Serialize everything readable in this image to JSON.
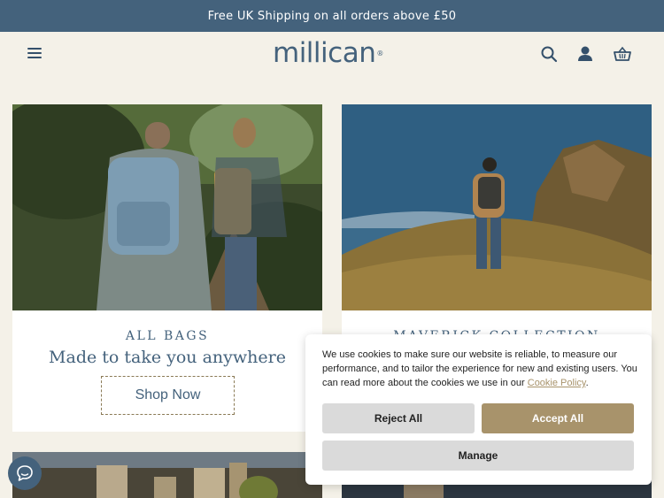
{
  "promo_bar": {
    "text": "Free UK Shipping on all orders above £50"
  },
  "header": {
    "logo_text": "millican",
    "logo_mark": "®",
    "icons": [
      "menu-icon",
      "search-icon",
      "account-icon",
      "basket-icon"
    ]
  },
  "cards": [
    {
      "eyebrow": "ALL BAGS",
      "title": "Made to take you anywhere",
      "button": "Shop Now"
    },
    {
      "eyebrow": "MAVERICK COLLECTION"
    }
  ],
  "cookie_banner": {
    "text_before": "We use cookies to make sure our website is reliable, to measure our performance, and to tailor the experience for new and existing users. You can read more about the cookies we use in our ",
    "link_text": "Cookie Policy",
    "text_after": ".",
    "reject_label": "Reject All",
    "accept_label": "Accept All",
    "manage_label": "Manage"
  },
  "colors": {
    "brand_blue": "#44627c",
    "background": "#f4f1e8",
    "accent_tan": "#a8936b",
    "reject_grey": "#dadada"
  }
}
